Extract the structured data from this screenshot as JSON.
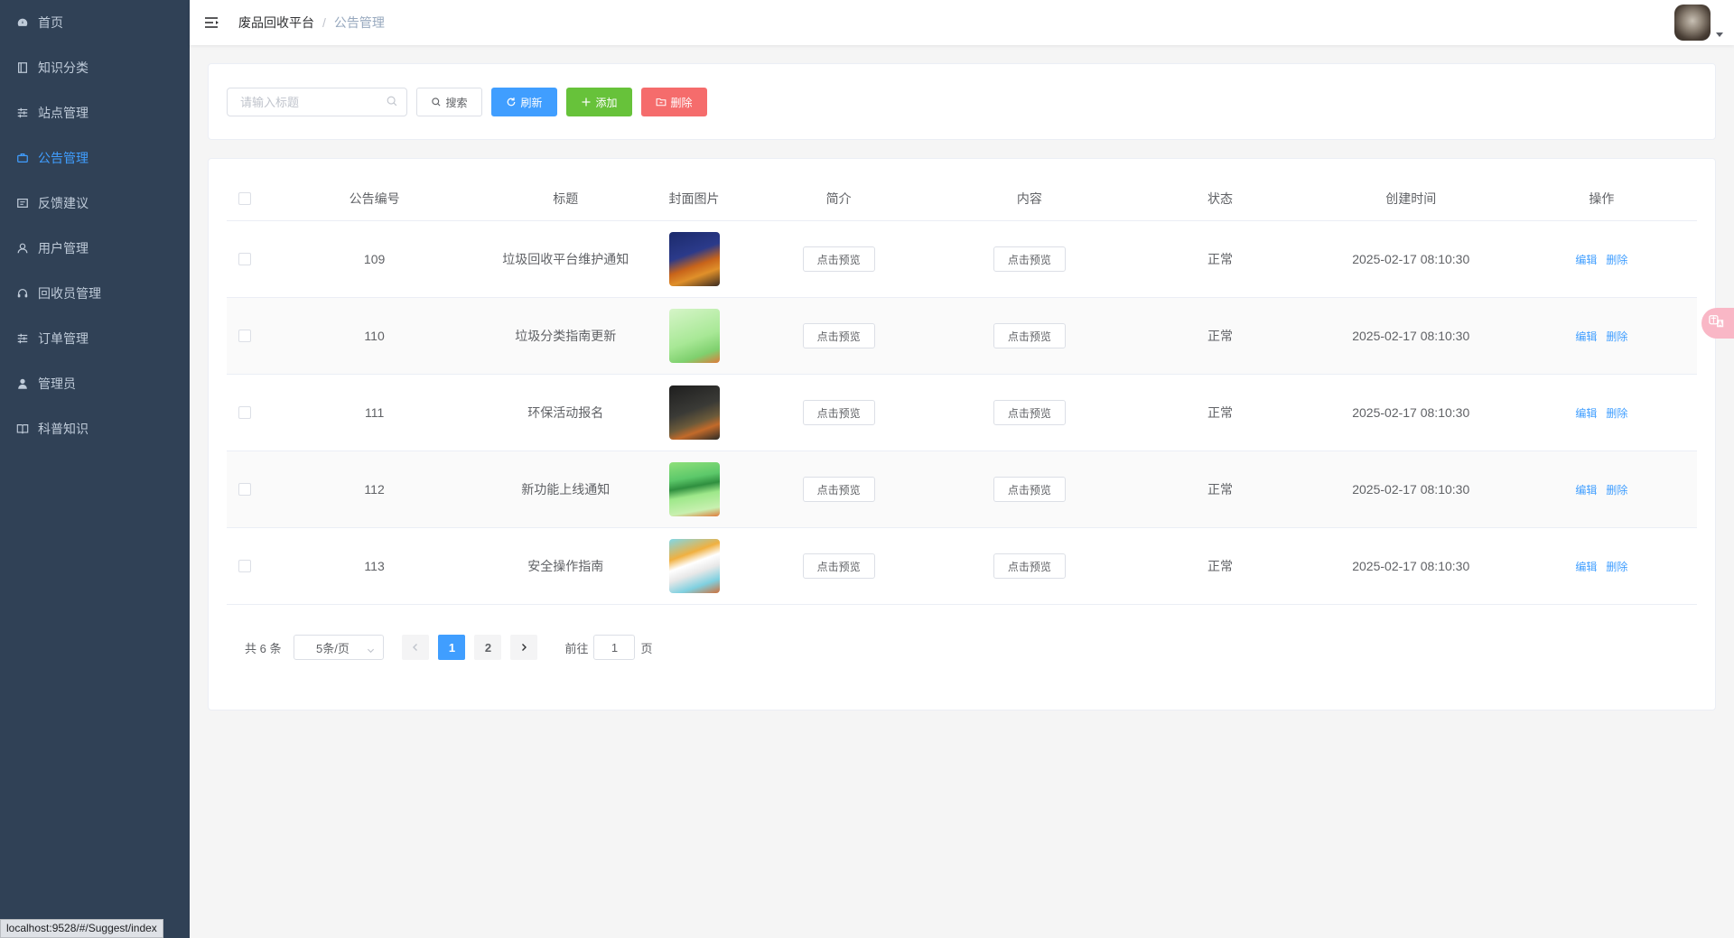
{
  "sidebar": {
    "items": [
      {
        "label": "首页",
        "icon": "dashboard-icon"
      },
      {
        "label": "知识分类",
        "icon": "book-icon"
      },
      {
        "label": "站点管理",
        "icon": "sliders-icon"
      },
      {
        "label": "公告管理",
        "icon": "briefcase-icon",
        "active": true
      },
      {
        "label": "反馈建议",
        "icon": "message-icon"
      },
      {
        "label": "用户管理",
        "icon": "user-icon"
      },
      {
        "label": "回收员管理",
        "icon": "headset-icon"
      },
      {
        "label": "订单管理",
        "icon": "sliders-icon"
      },
      {
        "label": "管理员",
        "icon": "admin-user-icon"
      },
      {
        "label": "科普知识",
        "icon": "open-book-icon"
      }
    ]
  },
  "header": {
    "breadcrumb": {
      "root": "废品回收平台",
      "separator": "/",
      "current": "公告管理"
    }
  },
  "toolbar": {
    "search_placeholder": "请输入标题",
    "search_value": "",
    "search_label": "搜索",
    "refresh_label": "刷新",
    "add_label": "添加",
    "delete_label": "删除"
  },
  "table": {
    "columns": [
      "公告编号",
      "标题",
      "封面图片",
      "简介",
      "内容",
      "状态",
      "创建时间",
      "操作"
    ],
    "rows": [
      {
        "id": "109",
        "title": "垃圾回收平台维护通知",
        "intro": "点击预览",
        "content": "点击预览",
        "status": "正常",
        "created": "2025-02-17 08:10:30",
        "edit": "编辑",
        "delete": "删除"
      },
      {
        "id": "110",
        "title": "垃圾分类指南更新",
        "intro": "点击预览",
        "content": "点击预览",
        "status": "正常",
        "created": "2025-02-17 08:10:30",
        "edit": "编辑",
        "delete": "删除"
      },
      {
        "id": "111",
        "title": "环保活动报名",
        "intro": "点击预览",
        "content": "点击预览",
        "status": "正常",
        "created": "2025-02-17 08:10:30",
        "edit": "编辑",
        "delete": "删除"
      },
      {
        "id": "112",
        "title": "新功能上线通知",
        "intro": "点击预览",
        "content": "点击预览",
        "status": "正常",
        "created": "2025-02-17 08:10:30",
        "edit": "编辑",
        "delete": "删除"
      },
      {
        "id": "113",
        "title": "安全操作指南",
        "intro": "点击预览",
        "content": "点击预览",
        "status": "正常",
        "created": "2025-02-17 08:10:30",
        "edit": "编辑",
        "delete": "删除"
      }
    ]
  },
  "pagination": {
    "total_text": "共 6 条",
    "page_size": "5条/页",
    "pages": [
      "1",
      "2"
    ],
    "current_page": "1",
    "goto_prefix": "前往",
    "goto_value": "1",
    "goto_suffix": "页"
  },
  "status_bar": {
    "url": "localhost:9528/#/Suggest/index"
  },
  "colors": {
    "sidebar_bg": "#304156",
    "primary": "#409eff",
    "success": "#67c23a",
    "danger": "#f56c6c"
  }
}
